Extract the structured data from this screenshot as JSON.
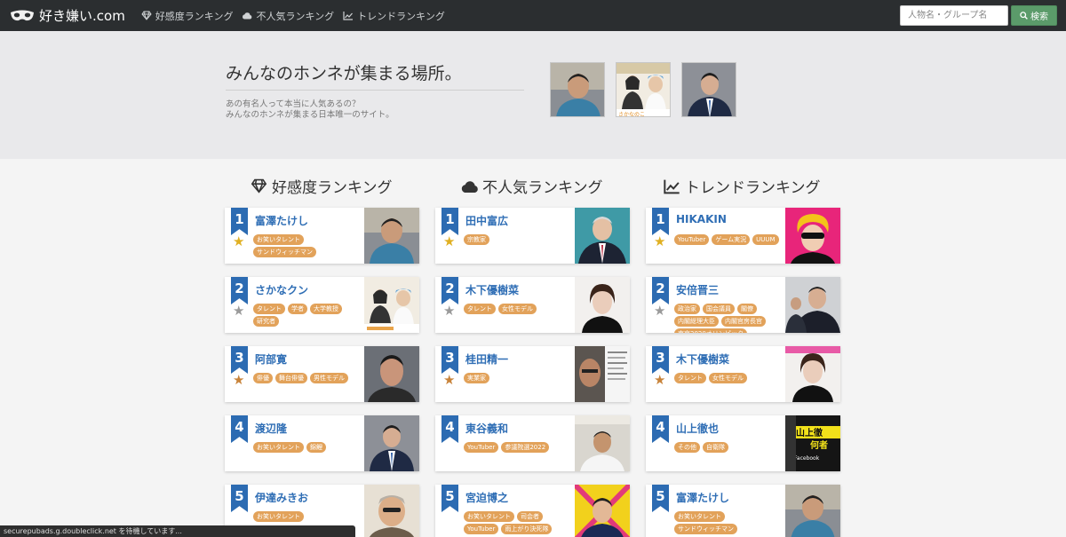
{
  "nav": {
    "brand": "好き嫌い.com",
    "links": [
      {
        "label": "好感度ランキング",
        "icon": "diamond-icon"
      },
      {
        "label": "不人気ランキング",
        "icon": "cloud-icon"
      },
      {
        "label": "トレンドランキング",
        "icon": "line-chart-icon"
      }
    ],
    "search_placeholder": "人物名・グループ名",
    "search_button": "検索"
  },
  "hero": {
    "title": "みんなのホンネが集まる場所。",
    "sub1": "あの有名人って本当に人気あるの？",
    "sub2": "みんなのホンネが集まる日本唯一のサイト。",
    "photo_caption": "さかなのこ"
  },
  "columns": [
    {
      "title": "好感度ランキング",
      "icon": "diamond-icon",
      "items": [
        {
          "rank": "1",
          "name": "富澤たけし",
          "tags": [
            "お笑いタレント",
            "サンドウィッチマン"
          ],
          "star": "gold"
        },
        {
          "rank": "2",
          "name": "さかなクン",
          "tags": [
            "タレント",
            "学者",
            "大学教授",
            "研究者"
          ],
          "star": "silver"
        },
        {
          "rank": "3",
          "name": "阿部寛",
          "tags": [
            "俳優",
            "舞台俳優",
            "男性モデル"
          ],
          "star": "bronze"
        },
        {
          "rank": "4",
          "name": "渡辺隆",
          "tags": [
            "お笑いタレント",
            "錦鯉"
          ],
          "star": ""
        },
        {
          "rank": "5",
          "name": "伊達みきお",
          "tags": [
            "お笑いタレント"
          ],
          "star": ""
        }
      ]
    },
    {
      "title": "不人気ランキング",
      "icon": "cloud-icon",
      "items": [
        {
          "rank": "1",
          "name": "田中富広",
          "tags": [
            "宗教家"
          ],
          "star": "gold"
        },
        {
          "rank": "2",
          "name": "木下優樹菜",
          "tags": [
            "タレント",
            "女性モデル"
          ],
          "star": "silver"
        },
        {
          "rank": "3",
          "name": "桂田精一",
          "tags": [
            "実業家"
          ],
          "star": "bronze"
        },
        {
          "rank": "4",
          "name": "東谷義和",
          "tags": [
            "YouTuber",
            "参議院選2022"
          ],
          "star": ""
        },
        {
          "rank": "5",
          "name": "宮迫博之",
          "tags": [
            "お笑いタレント",
            "司会者",
            "YouTuber",
            "雨上がり決死隊"
          ],
          "star": ""
        }
      ]
    },
    {
      "title": "トレンドランキング",
      "icon": "line-chart-icon",
      "items": [
        {
          "rank": "1",
          "name": "HIKAKIN",
          "tags": [
            "YouTuber",
            "ゲーム実況",
            "UUUM"
          ],
          "star": "gold"
        },
        {
          "rank": "2",
          "name": "安倍晋三",
          "tags": [
            "政治家",
            "国会議員",
            "閣僚",
            "内閣総理大臣",
            "内閣官房長官",
            "東京2020オリンピック"
          ],
          "star": "silver"
        },
        {
          "rank": "3",
          "name": "木下優樹菜",
          "tags": [
            "タレント",
            "女性モデル"
          ],
          "star": "bronze"
        },
        {
          "rank": "4",
          "name": "山上徹也",
          "tags": [
            "その他",
            "自衛隊"
          ],
          "star": ""
        },
        {
          "rank": "5",
          "name": "富澤たけし",
          "tags": [
            "お笑いタレント",
            "サンドウィッチマン"
          ],
          "star": ""
        }
      ]
    }
  ],
  "thumb_texts": {
    "yamagami_1": "山上徹",
    "yamagami_2": "何者",
    "yamagami_3": "Facebook"
  },
  "colors": {
    "nav_bg": "#2b2e30",
    "ribbon": "#2c6bb2",
    "tag": "#e2a25a",
    "name": "#2f6eb5",
    "star_gold": "#e0b022",
    "star_silver": "#9a9a9a",
    "star_bronze": "#c8833a"
  },
  "status": "securepubads.g.doubleclick.net を待機しています..."
}
